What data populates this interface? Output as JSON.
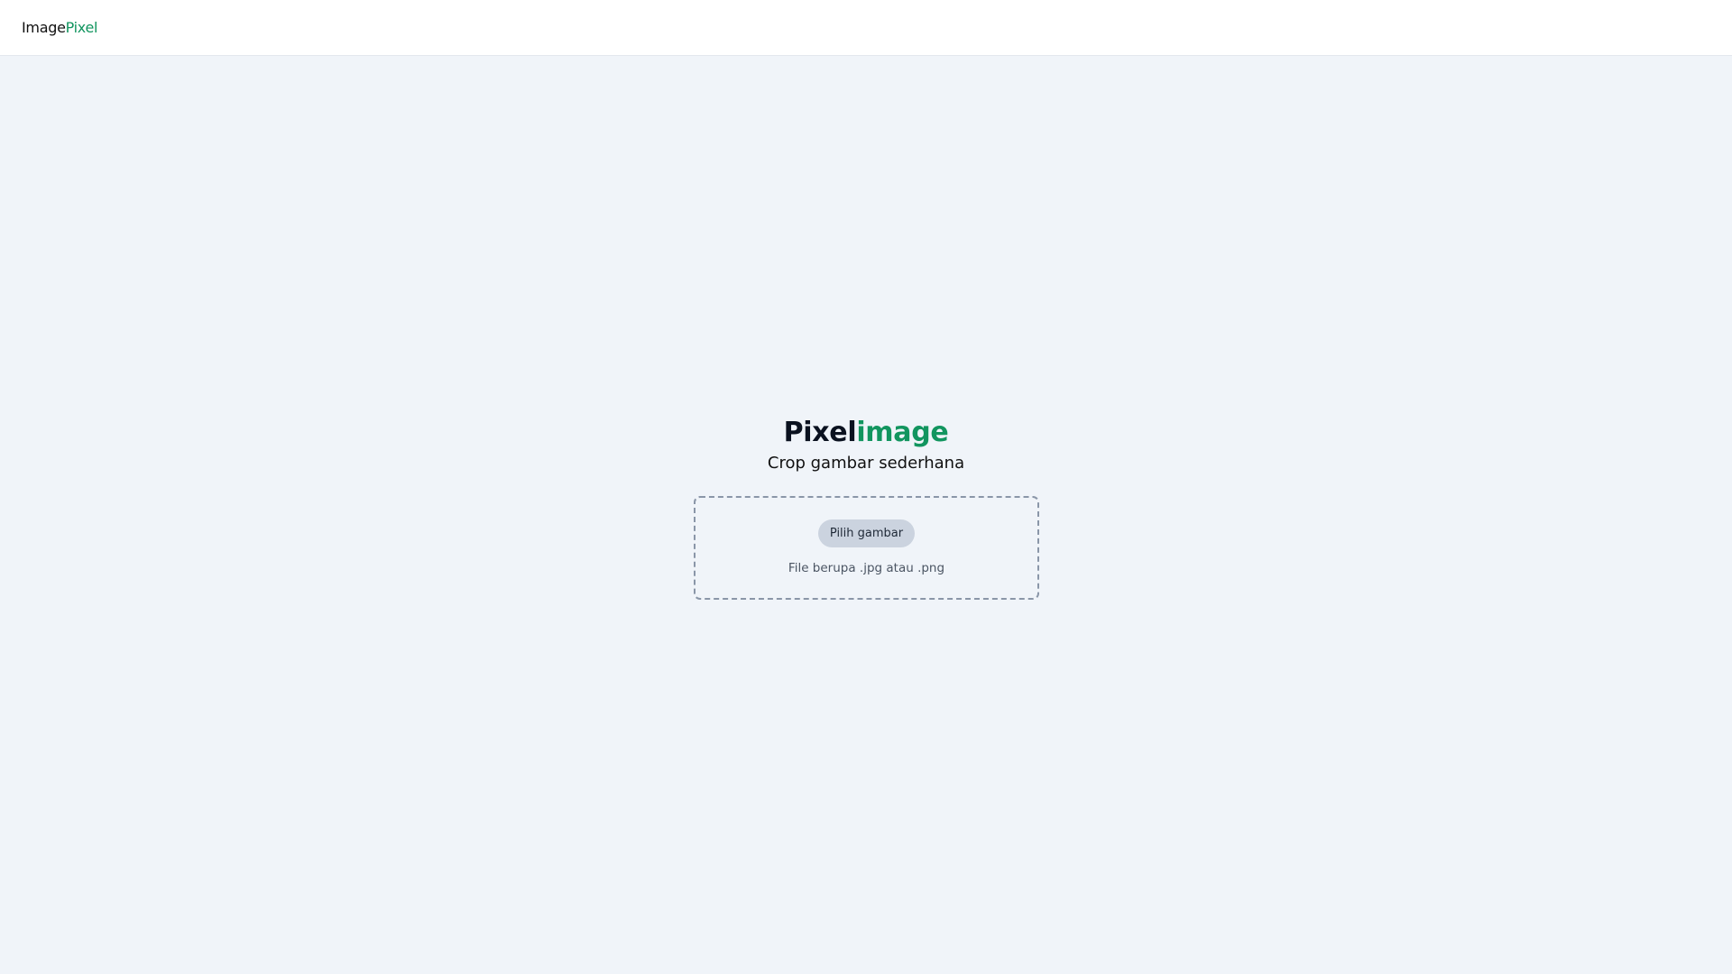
{
  "header": {
    "logo_part1": "Image",
    "logo_part2": "Pixel"
  },
  "hero": {
    "title_part1": "Pixel",
    "title_part2": "image",
    "subtitle": "Crop gambar sederhana"
  },
  "upload": {
    "button_label": "Pilih gambar",
    "hint": "File berupa .jpg atau .png"
  },
  "colors": {
    "accent": "#12955f",
    "background": "#f0f4f9",
    "button_bg": "#cbd3df"
  }
}
